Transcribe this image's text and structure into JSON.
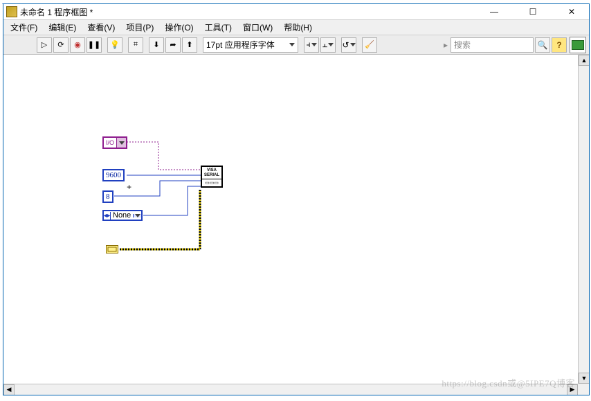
{
  "window": {
    "title": "未命名 1 程序框图 *",
    "minimize": "—",
    "maximize": "☐",
    "close": "✕"
  },
  "menu": {
    "file": "文件(F)",
    "edit": "编辑(E)",
    "view": "查看(V)",
    "project": "项目(P)",
    "operate": "操作(O)",
    "tools": "工具(T)",
    "window": "窗口(W)",
    "help": "帮助(H)"
  },
  "toolbar": {
    "run": "▷",
    "run_cont": "⟳",
    "abort": "◉",
    "pause": "❚❚",
    "highlight": "💡",
    "retain": "⌗",
    "step_into": "⬇",
    "step_over": "➦",
    "step_out": "⬆",
    "font_label": "17pt 应用程序字体",
    "align": "⫞",
    "distribute": "⫠",
    "reorder": "↺",
    "cleanup": "🧹",
    "search_sep": "▸",
    "search_placeholder": "搜索",
    "search_icon": "🔍",
    "help": "?"
  },
  "diagram": {
    "visa_resource": "I/O",
    "baud_rate": "9600",
    "data_bits": "8",
    "parity": "None",
    "visa_serial_label_top": "VISA",
    "visa_serial_label_bot": "SERIAL",
    "visa_serial_icon": "▭▭▭"
  },
  "scroll": {
    "left": "◀",
    "right": "▶",
    "up": "▲",
    "down": "▼"
  },
  "watermark": "https://blog.csdn或@5IPE7Q博客"
}
